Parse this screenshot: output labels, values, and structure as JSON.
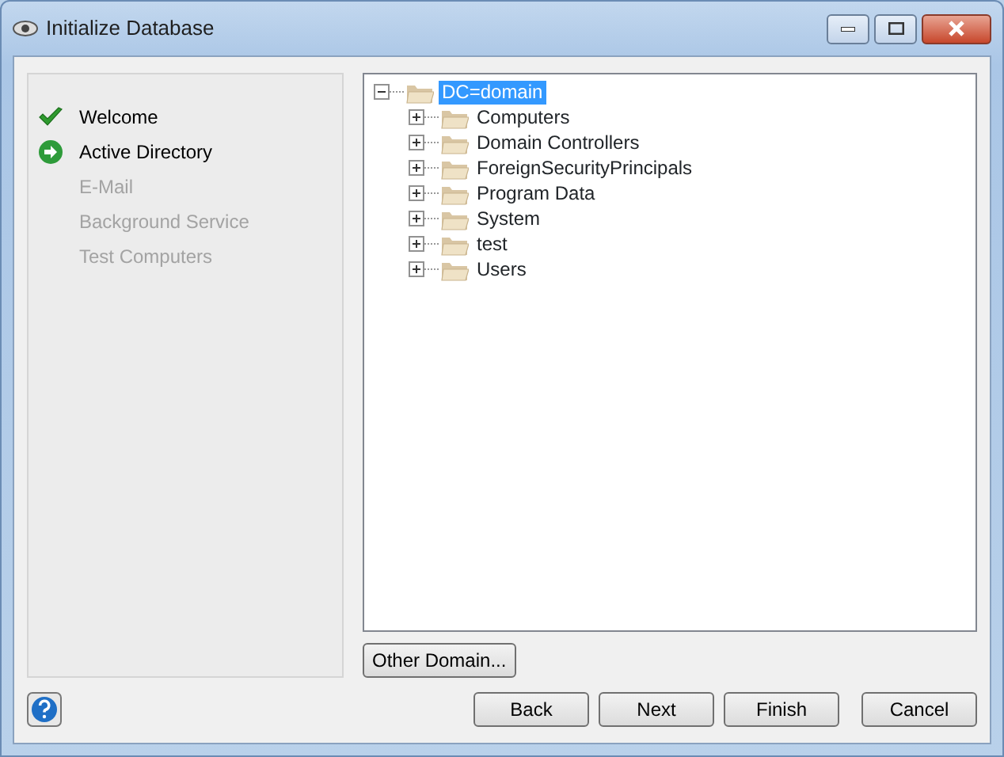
{
  "window": {
    "title": "Initialize Database"
  },
  "steps": [
    {
      "label": "Welcome",
      "kind": "done"
    },
    {
      "label": "Active Directory",
      "kind": "current"
    },
    {
      "label": "E-Mail",
      "kind": "pending"
    },
    {
      "label": "Background Service",
      "kind": "pending"
    },
    {
      "label": "Test Computers",
      "kind": "pending"
    }
  ],
  "tree": [
    {
      "label": "DC=domain",
      "expanded": true,
      "selected": true,
      "children": [
        {
          "label": "Computers",
          "expanded": false,
          "selected": false
        },
        {
          "label": "Domain Controllers",
          "expanded": false,
          "selected": false
        },
        {
          "label": "ForeignSecurityPrincipals",
          "expanded": false,
          "selected": false
        },
        {
          "label": "Program Data",
          "expanded": false,
          "selected": false
        },
        {
          "label": "System",
          "expanded": false,
          "selected": false
        },
        {
          "label": "test",
          "expanded": false,
          "selected": false
        },
        {
          "label": "Users",
          "expanded": false,
          "selected": false
        }
      ]
    }
  ],
  "other_domain_button": "Other Domain...",
  "buttons": [
    "Back",
    "Next",
    "Finish",
    "Cancel"
  ]
}
